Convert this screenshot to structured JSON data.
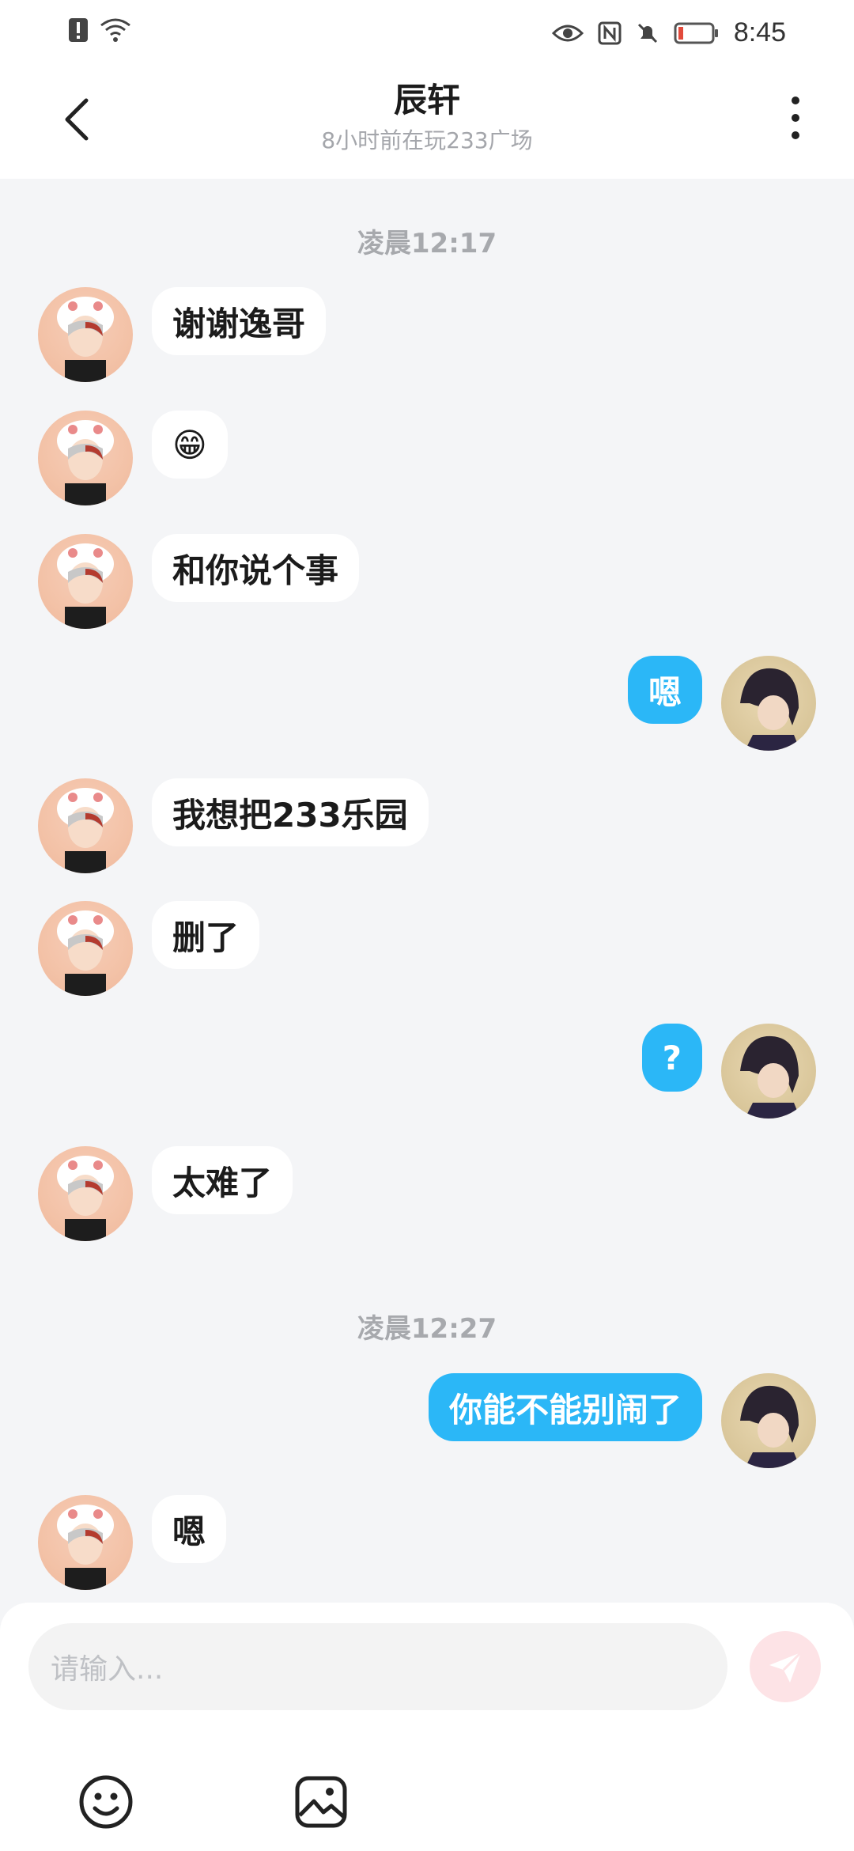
{
  "status_bar": {
    "time": "8:45"
  },
  "header": {
    "title": "辰轩",
    "subtitle": "8小时前在玩233广场"
  },
  "chat": {
    "timestamps": [
      "凌晨12:17",
      "凌晨12:27"
    ],
    "messages": [
      {
        "sender": "other",
        "text": "谢谢逸哥"
      },
      {
        "sender": "other",
        "text": "😁"
      },
      {
        "sender": "other",
        "text": "和你说个事"
      },
      {
        "sender": "self",
        "text": "嗯"
      },
      {
        "sender": "other",
        "text": "我想把233乐园"
      },
      {
        "sender": "other",
        "text": "删了"
      },
      {
        "sender": "self",
        "text": "?"
      },
      {
        "sender": "other",
        "text": "太难了"
      },
      {
        "sender": "self",
        "text": "你能不能别闹了"
      },
      {
        "sender": "other",
        "text": "嗯"
      }
    ]
  },
  "input": {
    "placeholder": "请输入..."
  },
  "colors": {
    "self_bubble": "#2bb7f7",
    "other_bubble": "#ffffff",
    "background": "#f4f5f7",
    "send_button": "#fde3e6"
  },
  "icons": [
    "back-icon",
    "more-vertical-icon",
    "send-icon",
    "emoji-icon",
    "image-icon"
  ]
}
